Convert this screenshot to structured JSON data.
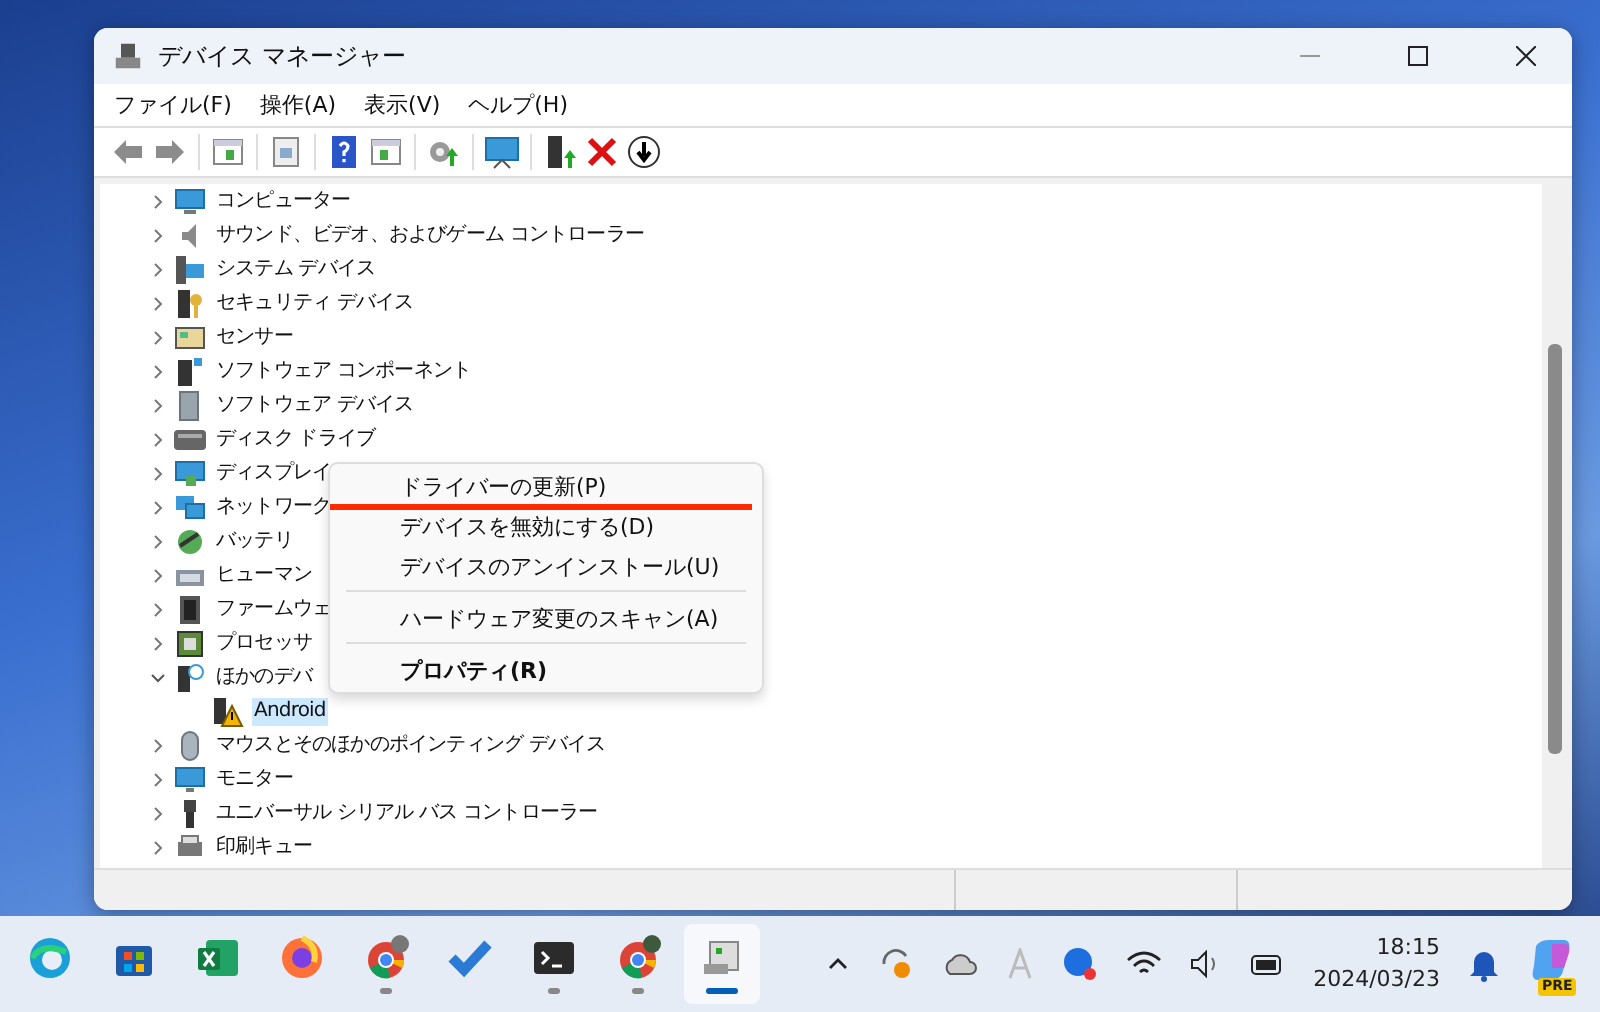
{
  "window": {
    "title": "デバイス マネージャー"
  },
  "menu_bar": [
    "ファイル(F)",
    "操作(A)",
    "表示(V)",
    "ヘルプ(H)"
  ],
  "tree": [
    {
      "label": "コンピューター",
      "expanded": false
    },
    {
      "label": "サウンド、ビデオ、およびゲーム コントローラー",
      "expanded": false
    },
    {
      "label": "システム デバイス",
      "expanded": false
    },
    {
      "label": "セキュリティ デバイス",
      "expanded": false
    },
    {
      "label": "センサー",
      "expanded": false
    },
    {
      "label": "ソフトウェア コンポーネント",
      "expanded": false
    },
    {
      "label": "ソフトウェア デバイス",
      "expanded": false
    },
    {
      "label": "ディスク ドライブ",
      "expanded": false
    },
    {
      "label": "ディスプレイ",
      "expanded": false
    },
    {
      "label": "ネットワーク",
      "expanded": false
    },
    {
      "label": "バッテリ",
      "expanded": false
    },
    {
      "label": "ヒューマン",
      "expanded": false
    },
    {
      "label": "ファームウェ",
      "expanded": false
    },
    {
      "label": "プロセッサ",
      "expanded": false
    },
    {
      "label": "ほかのデバ",
      "expanded": true,
      "children": [
        {
          "label": "Android",
          "selected": true
        }
      ]
    },
    {
      "label": "マウスとそのほかのポインティング デバイス",
      "expanded": false
    },
    {
      "label": "モニター",
      "expanded": false
    },
    {
      "label": "ユニバーサル シリアル バス コントローラー",
      "expanded": false
    },
    {
      "label": "印刷キュー",
      "expanded": false
    }
  ],
  "context_menu": [
    {
      "kind": "item",
      "label": "ドライバーの更新(P)",
      "bold": false,
      "underlined": true
    },
    {
      "kind": "item",
      "label": "デバイスを無効にする(D)",
      "bold": false,
      "underlined": false
    },
    {
      "kind": "item",
      "label": "デバイスのアンインストール(U)",
      "bold": false,
      "underlined": false
    },
    {
      "kind": "separator"
    },
    {
      "kind": "item",
      "label": "ハードウェア変更のスキャン(A)",
      "bold": false,
      "underlined": false
    },
    {
      "kind": "separator"
    },
    {
      "kind": "item",
      "label": "プロパティ(R)",
      "bold": true,
      "underlined": false
    }
  ],
  "taskbar": {
    "apps": [
      {
        "running": false,
        "active": false
      },
      {
        "running": false,
        "active": false
      },
      {
        "running": false,
        "active": false
      },
      {
        "running": false,
        "active": false
      },
      {
        "running": true,
        "active": false
      },
      {
        "running": false,
        "active": false
      },
      {
        "running": true,
        "active": false
      },
      {
        "running": true,
        "active": false
      },
      {
        "running": true,
        "active": true
      }
    ],
    "copilot_badge": "PRE",
    "time": "18:15",
    "date": "2024/03/23"
  }
}
